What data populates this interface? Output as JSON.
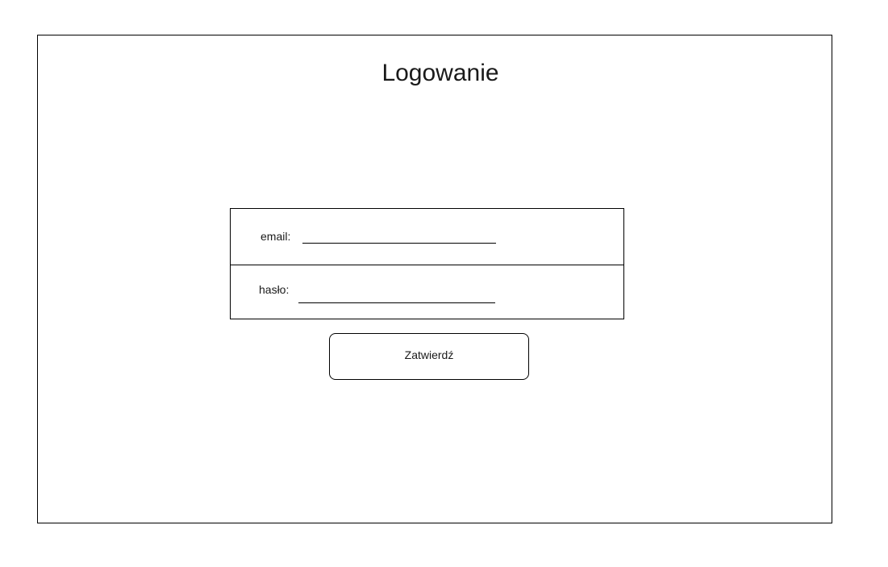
{
  "page": {
    "title": "Logowanie"
  },
  "form": {
    "email_label": "email:",
    "email_value": "",
    "password_label": "hasło:",
    "password_value": ""
  },
  "actions": {
    "submit_label": "Zatwierdź"
  }
}
